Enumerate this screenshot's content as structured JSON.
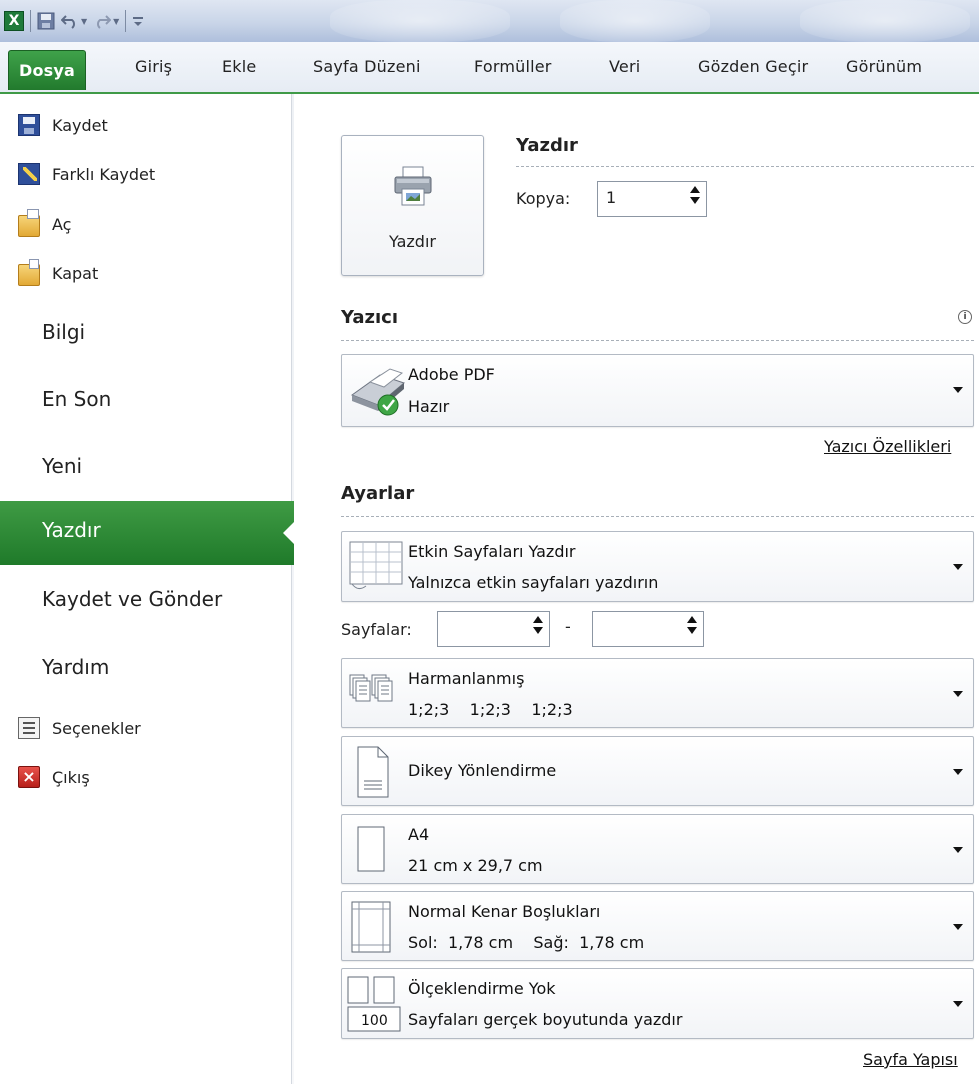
{
  "quick_access": {
    "app_logo": "X",
    "icons": [
      "excel-logo-icon",
      "save-icon",
      "undo-icon",
      "redo-icon",
      "customize-qat-icon"
    ]
  },
  "ribbon_tabs": [
    "Dosya",
    "Giriş",
    "Ekle",
    "Sayfa Düzeni",
    "Formüller",
    "Veri",
    "Gözden Geçir",
    "Görünüm"
  ],
  "backstage_nav": {
    "small_items": [
      {
        "label": "Kaydet",
        "icon": "save-icon"
      },
      {
        "label": "Farklı Kaydet",
        "icon": "save-as-icon"
      },
      {
        "label": "Aç",
        "icon": "open-folder-icon"
      },
      {
        "label": "Kapat",
        "icon": "close-folder-icon"
      }
    ],
    "large_items": [
      "Bilgi",
      "En Son",
      "Yeni",
      "Yazdır",
      "Kaydet ve Gönder",
      "Yardım"
    ],
    "active": "Yazdır",
    "bottom_items": [
      {
        "label": "Seçenekler",
        "icon": "options-icon"
      },
      {
        "label": "Çıkış",
        "icon": "exit-icon"
      }
    ]
  },
  "print": {
    "button_label": "Yazdır",
    "section_title": "Yazdır",
    "copies_label": "Kopya:",
    "copies_value": "1"
  },
  "printer": {
    "section_title": "Yazıcı",
    "name": "Adobe PDF",
    "status": "Hazır",
    "properties_link": "Yazıcı Özellikleri"
  },
  "settings": {
    "section_title": "Ayarlar",
    "print_what": {
      "main": "Etkin Sayfaları Yazdır",
      "sub": "Yalnızca etkin sayfaları yazdırın"
    },
    "pages_label": "Sayfalar:",
    "pages_from": "",
    "pages_to": "",
    "pages_separator": "-",
    "collation": {
      "main": "Harmanlanmış",
      "sub": "1;2;3    1;2;3    1;2;3"
    },
    "orientation": {
      "main": "Dikey Yönlendirme"
    },
    "paper": {
      "main": "A4",
      "sub": "21 cm x 29,7 cm"
    },
    "margins": {
      "main": "Normal Kenar Boşlukları",
      "sub": "Sol:  1,78 cm    Sağ:  1,78 cm"
    },
    "scaling": {
      "main": "Ölçeklendirme Yok",
      "sub": "Sayfaları gerçek boyutunda yazdır",
      "icon_text": "100"
    },
    "page_setup_link": "Sayfa Yapısı"
  },
  "colors": {
    "accent_green": "#2b8a35",
    "ribbon_blue": "#c9d5e8"
  }
}
